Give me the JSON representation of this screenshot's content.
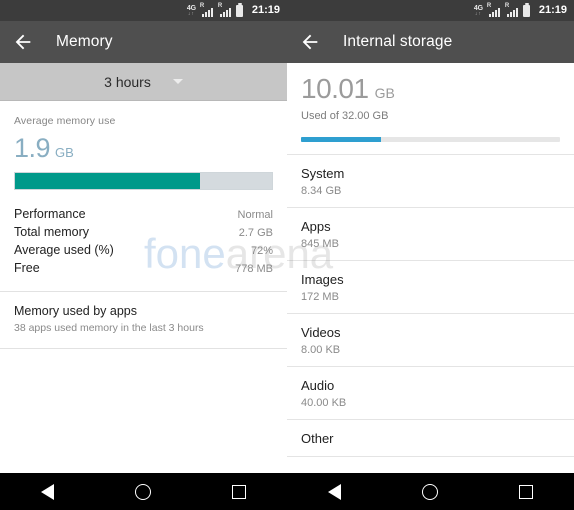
{
  "status_bar": {
    "network_type": "4G",
    "data_arrows": "↓↑",
    "roaming_label": "R",
    "time": "21:19"
  },
  "watermark": {
    "part1": "fone",
    "part2": "arena"
  },
  "memory_screen": {
    "title": "Memory",
    "back_icon": "back-arrow-icon",
    "period_selector": {
      "value": "3 hours",
      "caret_icon": "chevron-down-icon"
    },
    "average_caption": "Average memory use",
    "average_value": "1.9",
    "average_unit": "GB",
    "usage_percent": 72,
    "bar_color": "#00998a",
    "stats": [
      {
        "key": "Performance",
        "value": "Normal"
      },
      {
        "key": "Total memory",
        "value": "2.7 GB"
      },
      {
        "key": "Average used (%)",
        "value": "72%"
      },
      {
        "key": "Free",
        "value": "778 MB"
      }
    ],
    "apps_row": {
      "title": "Memory used by apps",
      "subtitle": "38 apps used memory in the last 3 hours"
    }
  },
  "storage_screen": {
    "title": "Internal storage",
    "back_icon": "back-arrow-icon",
    "used_value": "10.01",
    "used_unit": "GB",
    "used_of": "Used of 32.00 GB",
    "usage_percent": 31,
    "bar_color": "#2e9fd0",
    "items": [
      {
        "name": "System",
        "size": "8.34 GB"
      },
      {
        "name": "Apps",
        "size": "845 MB"
      },
      {
        "name": "Images",
        "size": "172 MB"
      },
      {
        "name": "Videos",
        "size": "8.00 KB"
      },
      {
        "name": "Audio",
        "size": "40.00 KB"
      },
      {
        "name": "Other",
        "size": ""
      }
    ]
  },
  "nav_bar": {
    "back_icon": "triangle-back-icon",
    "home_icon": "circle-home-icon",
    "recents_icon": "square-recents-icon"
  }
}
